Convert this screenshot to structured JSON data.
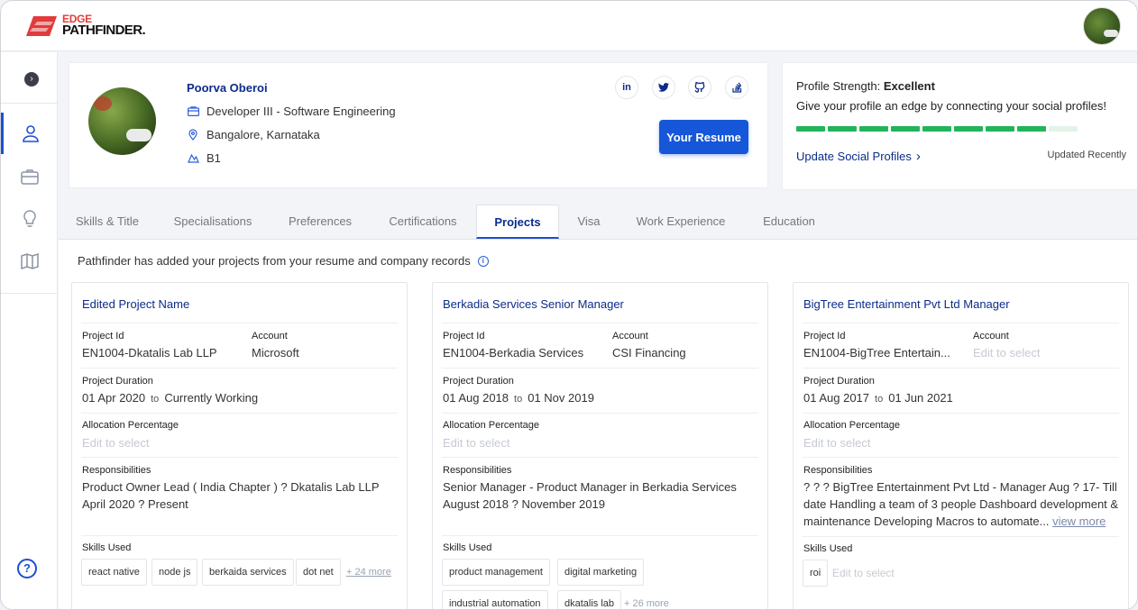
{
  "brand": {
    "line1": "EDGE",
    "line2": "PATHFINDER."
  },
  "profile": {
    "name": "Poorva Oberoi",
    "role": "Developer III - Software Engineering",
    "location": "Bangalore, Karnataka",
    "band": "B1",
    "socials": [
      {
        "icon": "linkedin-icon",
        "glyph": "in"
      },
      {
        "icon": "twitter-icon",
        "glyph": "t"
      },
      {
        "icon": "github-icon",
        "glyph": "gh"
      },
      {
        "icon": "stackoverflow-icon",
        "glyph": "so"
      }
    ],
    "resume_button": "Your Resume"
  },
  "strength": {
    "label": "Profile Strength:",
    "value": "Excellent",
    "subtitle": "Give your profile an edge by connecting your social profiles!",
    "filled_segments": 8,
    "total_segments": 9,
    "link": "Update Social Profiles",
    "updated": "Updated Recently",
    "bar_color": "#21b45a"
  },
  "tabs": [
    {
      "label": "Skills & Title",
      "active": false
    },
    {
      "label": "Specialisations",
      "active": false
    },
    {
      "label": "Preferences",
      "active": false
    },
    {
      "label": "Certifications",
      "active": false
    },
    {
      "label": "Projects",
      "active": true
    },
    {
      "label": "Visa",
      "active": false
    },
    {
      "label": "Work Experience",
      "active": false
    },
    {
      "label": "Education",
      "active": false
    }
  ],
  "projects_info": "Pathfinder has added your projects from your resume and company records",
  "labels": {
    "project_id": "Project Id",
    "account": "Account",
    "duration": "Project Duration",
    "to": "to",
    "allocation": "Allocation Percentage",
    "responsibilities": "Responsibilities",
    "skills": "Skills Used",
    "edit_to_select": "Edit to select",
    "view_more": "view more"
  },
  "projects": [
    {
      "title": "Edited Project Name",
      "project_id": "EN1004-Dkatalis Lab LLP",
      "account": "Microsoft",
      "start": "01 Apr 2020",
      "end": "Currently Working",
      "allocation": "Edit to select",
      "responsibilities": "Product Owner Lead ( India Chapter ) ? Dkatalis Lab LLP April 2020 ? Present",
      "skills": [
        "react native",
        "node js",
        "berkaida services",
        "dot net"
      ],
      "more": "+ 24 more"
    },
    {
      "title": "Berkadia Services Senior Manager",
      "project_id": "EN1004-Berkadia Services",
      "account": "CSI Financing",
      "start": "01 Aug 2018",
      "end": "01 Nov 2019",
      "allocation": "Edit to select",
      "responsibilities": "Senior Manager - Product Manager in Berkadia Services August 2018 ? November 2019",
      "skills": [
        "product management",
        "digital marketing",
        "industrial automation",
        "dkatalis lab"
      ],
      "more": "+ 26 more"
    },
    {
      "title": "BigTree Entertainment Pvt Ltd Manager",
      "project_id": "EN1004-BigTree Entertain...",
      "account": "Edit to select",
      "start": "01 Aug 2017",
      "end": "01 Jun 2021",
      "allocation": "Edit to select",
      "responsibilities": "? ? ? BigTree Entertainment Pvt Ltd - Manager Aug ? 17- Till date Handling a team of 3 people Dashboard development & maintenance Developing Macros to automate...",
      "skills": [
        "roi"
      ],
      "more": "Edit to select"
    }
  ],
  "sidebar": {
    "items": [
      "profile-icon",
      "briefcase-icon",
      "lightbulb-icon",
      "map-icon"
    ],
    "help": "?"
  },
  "colors": {
    "accent": "#1557d8",
    "title_blue": "#0b2c8a",
    "brand_red": "#e23b3b"
  }
}
